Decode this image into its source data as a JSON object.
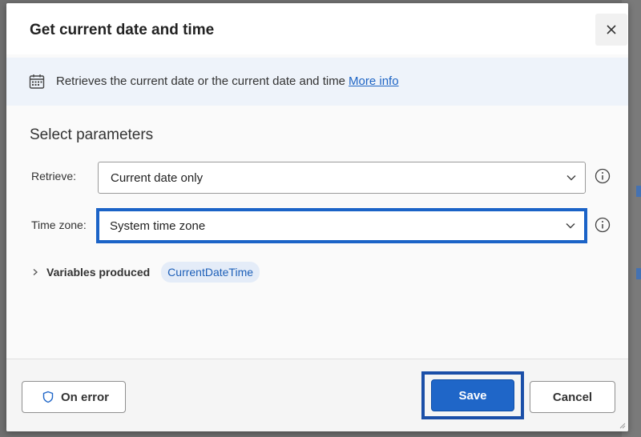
{
  "dialog": {
    "title": "Get current date and time",
    "close_icon": "close-icon"
  },
  "banner": {
    "icon": "calendar-icon",
    "text": "Retrieves the current date or the current date and time",
    "link": "More info"
  },
  "params": {
    "section_title": "Select parameters",
    "retrieve": {
      "label": "Retrieve:",
      "value": "Current date only"
    },
    "timezone": {
      "label": "Time zone:",
      "value": "System time zone"
    }
  },
  "variables": {
    "label": "Variables produced",
    "chip": "CurrentDateTime"
  },
  "footer": {
    "on_error": "On error",
    "save": "Save",
    "cancel": "Cancel"
  },
  "colors": {
    "accent": "#1f66c8",
    "focus_outline": "#1b63c7",
    "link": "#1d64c4",
    "banner_bg": "#eef3fa"
  }
}
